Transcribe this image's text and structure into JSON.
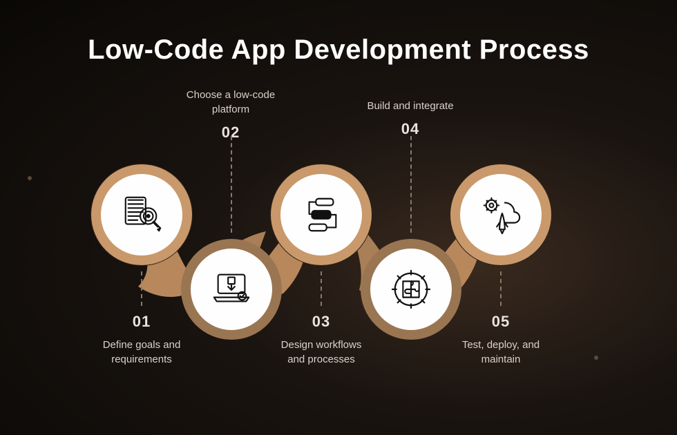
{
  "title": "Low-Code App Development Process",
  "colors": {
    "circle_fill": "#fefefe",
    "ring_top": "#c9996b",
    "ring_bot": "#9a7552",
    "connector_dash": "#8a7a68"
  },
  "steps": [
    {
      "number": "01",
      "label": "Define goals and requirements",
      "icon": "document-target-icon",
      "position": "top"
    },
    {
      "number": "02",
      "label": "Choose a low-code platform",
      "icon": "laptop-download-icon",
      "position": "bottom"
    },
    {
      "number": "03",
      "label": "Design workflows and processes",
      "icon": "workflow-blocks-icon",
      "position": "top"
    },
    {
      "number": "04",
      "label": "Build and integrate",
      "icon": "gear-puzzle-icon",
      "position": "bottom"
    },
    {
      "number": "05",
      "label": "Test, deploy, and maintain",
      "icon": "rocket-cloud-gear-icon",
      "position": "top"
    }
  ]
}
